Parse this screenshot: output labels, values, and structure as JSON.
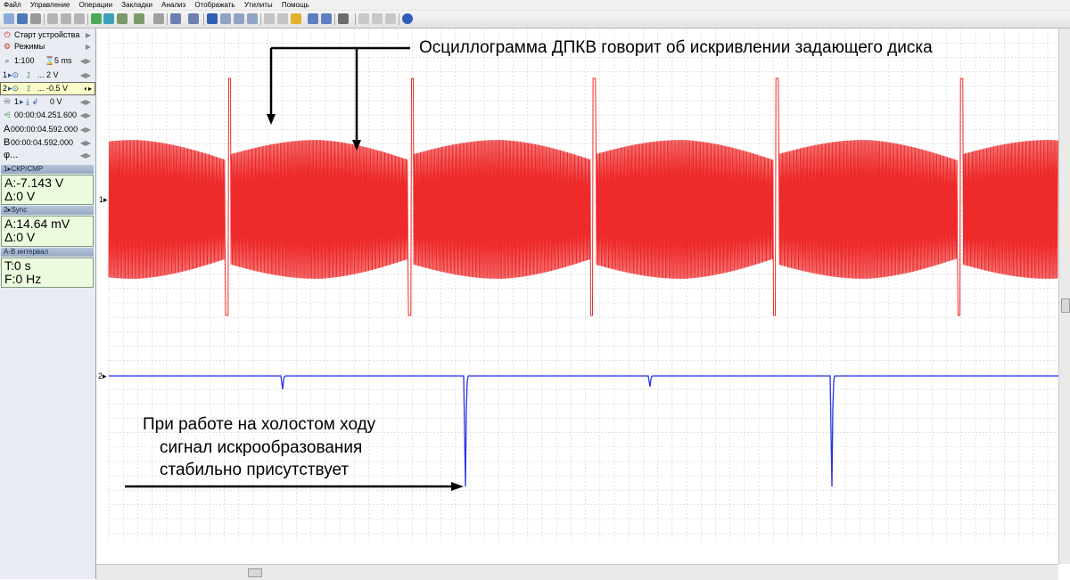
{
  "menu": [
    "Файл",
    "Управление",
    "Операции",
    "Закладки",
    "Анализ",
    "Отображать",
    "Утилиты",
    "Помощь"
  ],
  "sidebar": {
    "start_label": "Старт устройства",
    "modes_label": "Режимы",
    "scale_label": "1:100",
    "time_div": "5 ms",
    "ch1_setting": "... 2 V",
    "ch2_setting": "... -0.5 V",
    "trigger_setting": "0 V",
    "time_position": "00:00:04.251.600",
    "cursor_a": "000:00:04.592.000",
    "cursor_b": "00:00:04.592.000",
    "phi_label": "φ...",
    "cursor_a_letter": "A",
    "cursor_b_letter": "B",
    "trigger_label": "1",
    "ch1_num": "1",
    "ch2_num": "2"
  },
  "panels": [
    {
      "title": "1▸СКР/СМР",
      "line1": "A:-7.143 V",
      "line2": "Δ:0 V"
    },
    {
      "title": "2▸Sync",
      "line1": "A:14.64 mV",
      "line2": "Δ:0 V"
    },
    {
      "title": "А-В интервал",
      "line1": "T:0 s",
      "line2": "F:0 Hz"
    }
  ],
  "channels": {
    "ch1": {
      "marker": "1▸",
      "color": "#ee2a2a"
    },
    "ch2": {
      "marker": "2▸",
      "color": "#2a32e6"
    }
  },
  "annotations": {
    "top": "Осциллограмма ДПКВ говорит об искривлении задающего диска",
    "bottom_line1": "При работе на холостом ходу",
    "bottom_line2": "сигнал искрообразования",
    "bottom_line3": "стабильно присутствует"
  }
}
